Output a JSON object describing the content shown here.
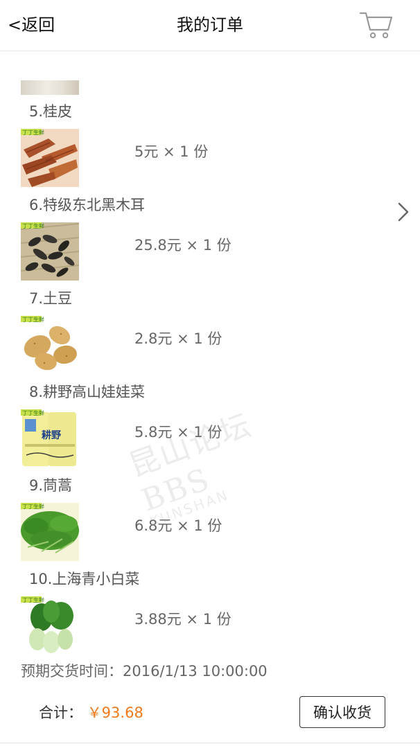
{
  "header": {
    "back_label": "<返回",
    "title": "我的订单",
    "cart_icon": "shopping-cart-icon"
  },
  "items": [
    {
      "name": "5.桂皮",
      "price": "5元 × 1 份",
      "image": "cinnamon"
    },
    {
      "name": "6.特级东北黑木耳",
      "price": "25.8元 × 1 份",
      "image": "black-fungus"
    },
    {
      "name": "7.土豆",
      "price": "2.8元 × 1 份",
      "image": "potato"
    },
    {
      "name": "8.耕野高山娃娃菜",
      "price": "5.8元 × 1 份",
      "image": "baby-cabbage"
    },
    {
      "name": "9.茼蒿",
      "price": "6.8元 × 1 份",
      "image": "crown-daisy"
    },
    {
      "name": "10.上海青小白菜",
      "price": "3.88元 × 1 份",
      "image": "bok-choy"
    }
  ],
  "thumb_badge": "丁丁生鲜",
  "package_label": "耕野",
  "delivery": {
    "label": "预期交货时间：2016/1/13 10:00:00"
  },
  "footer": {
    "total_label": "合计：",
    "total_amount": "￥93.68",
    "confirm_label": "确认收货"
  },
  "watermark": {
    "main": "昆山论坛 BBS",
    "sub": "KUNSHAN"
  },
  "colors": {
    "accent": "#f07a1a",
    "text": "#333333",
    "muted": "#666666",
    "divider": "#e3e3e3"
  },
  "nav": {
    "next_icon": "chevron-right-icon"
  }
}
